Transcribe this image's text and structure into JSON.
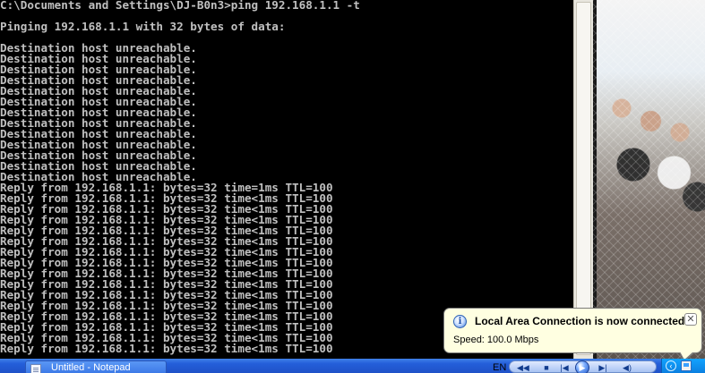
{
  "console": {
    "lines": [
      "C:\\Documents and Settings\\DJ-B0n3>ping 192.168.1.1 -t",
      "",
      "Pinging 192.168.1.1 with 32 bytes of data:",
      "",
      "Destination host unreachable.",
      "Destination host unreachable.",
      "Destination host unreachable.",
      "Destination host unreachable.",
      "Destination host unreachable.",
      "Destination host unreachable.",
      "Destination host unreachable.",
      "Destination host unreachable.",
      "Destination host unreachable.",
      "Destination host unreachable.",
      "Destination host unreachable.",
      "Destination host unreachable.",
      "Destination host unreachable.",
      "Reply from 192.168.1.1: bytes=32 time=1ms TTL=100",
      "Reply from 192.168.1.1: bytes=32 time<1ms TTL=100",
      "Reply from 192.168.1.1: bytes=32 time<1ms TTL=100",
      "Reply from 192.168.1.1: bytes=32 time<1ms TTL=100",
      "Reply from 192.168.1.1: bytes=32 time<1ms TTL=100",
      "Reply from 192.168.1.1: bytes=32 time<1ms TTL=100",
      "Reply from 192.168.1.1: bytes=32 time<1ms TTL=100",
      "Reply from 192.168.1.1: bytes=32 time<1ms TTL=100",
      "Reply from 192.168.1.1: bytes=32 time<1ms TTL=100",
      "Reply from 192.168.1.1: bytes=32 time<1ms TTL=100",
      "Reply from 192.168.1.1: bytes=32 time<1ms TTL=100",
      "Reply from 192.168.1.1: bytes=32 time<1ms TTL=100",
      "Reply from 192.168.1.1: bytes=32 time<1ms TTL=100",
      "Reply from 192.168.1.1: bytes=32 time<1ms TTL=100",
      "Reply from 192.168.1.1: bytes=32 time<1ms TTL=100",
      "Reply from 192.168.1.1: bytes=32 time<1ms TTL=100"
    ]
  },
  "notification": {
    "icon": "info-icon",
    "title": "Local Area Connection is now connected",
    "text": "Speed: 100.0 Mbps",
    "close_glyph": "✕"
  },
  "taskbar": {
    "task_label": "Untitled - Notepad",
    "task_icon": "notepad-icon",
    "language": "EN",
    "media_icons": [
      "rewind-icon",
      "stop-icon",
      "previous-icon",
      "play-icon",
      "next-icon",
      "volume-icon"
    ],
    "tray_icons": [
      "tray-expand-icon",
      "network-icon"
    ]
  }
}
